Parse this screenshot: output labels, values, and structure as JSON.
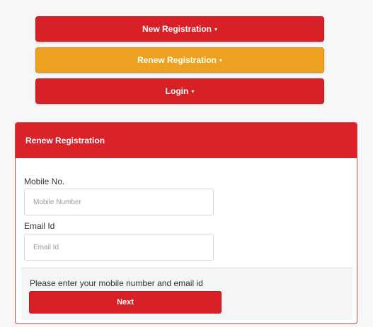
{
  "menu": {
    "new_registration": "New Registration",
    "renew_registration": "Renew Registration",
    "login": "Login",
    "caret": "▾"
  },
  "panel": {
    "title": "Renew Registration",
    "mobile_label": "Mobile No.",
    "mobile_placeholder": "Mobile Number",
    "email_label": "Email Id",
    "email_placeholder": "Email Id",
    "hint": "Please enter your mobile number and email id",
    "next_label": "Next"
  },
  "colors": {
    "primary_red": "#d82127",
    "accent_orange": "#eea121",
    "panel_border": "#d5463f"
  }
}
